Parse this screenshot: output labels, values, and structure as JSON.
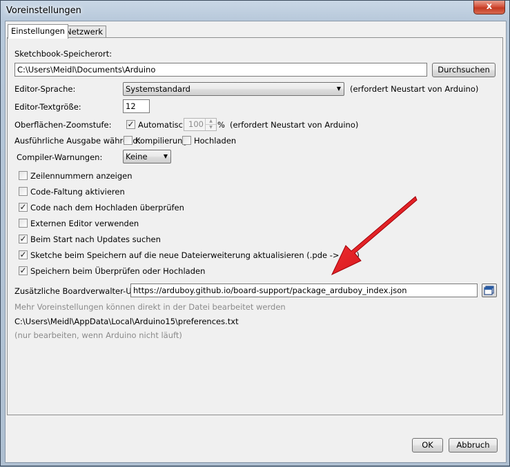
{
  "window": {
    "title": "Voreinstellungen",
    "close_glyph": "x"
  },
  "tabs": [
    {
      "label": "Einstellungen"
    },
    {
      "label": "Netzwerk"
    }
  ],
  "sketchbook": {
    "label": "Sketchbook-Speicherort:",
    "value": "C:\\Users\\Meidl\\Documents\\Arduino",
    "browse_label": "Durchsuchen"
  },
  "language": {
    "label": "Editor-Sprache:",
    "value": "Systemstandard",
    "note": "(erfordert Neustart von Arduino)"
  },
  "font_size": {
    "label": "Editor-Textgröße:",
    "value": "12"
  },
  "zoom": {
    "label": "Oberflächen-Zoomstufe:",
    "auto_label": "Automatisch",
    "auto_checked": true,
    "value": "100",
    "unit": "%",
    "note": "(erfordert Neustart von Arduino)"
  },
  "verbose": {
    "label": "Ausführliche Ausgabe während:",
    "compile_label": "Kompilierung",
    "compile_checked": false,
    "upload_label": "Hochladen",
    "upload_checked": false
  },
  "warnings": {
    "label": "Compiler-Warnungen:",
    "value": "Keine"
  },
  "options": [
    {
      "label": "Zeilennummern anzeigen",
      "checked": false
    },
    {
      "label": "Code-Faltung aktivieren",
      "checked": false
    },
    {
      "label": "Code nach dem Hochladen überprüfen",
      "checked": true
    },
    {
      "label": "Externen Editor verwenden",
      "checked": false
    },
    {
      "label": "Beim Start nach Updates suchen",
      "checked": true
    },
    {
      "label": "Sketche beim Speichern auf die neue Dateierweiterung aktualisieren (.pde -> .ino)",
      "checked": true
    },
    {
      "label": "Speichern beim Überprüfen oder Hochladen",
      "checked": true
    }
  ],
  "board_urls": {
    "label": "Zusätzliche Boardverwalter-URLs:",
    "value": "https://arduboy.github.io/board-support/package_arduboy_index.json"
  },
  "info": {
    "more_text": "Mehr Voreinstellungen können direkt in der Datei bearbeitet werden",
    "path": "C:\\Users\\Meidl\\AppData\\Local\\Arduino15\\preferences.txt",
    "hint": "(nur bearbeiten, wenn Arduino nicht läuft)"
  },
  "footer": {
    "ok_label": "OK",
    "cancel_label": "Abbruch"
  },
  "colors": {
    "arrow": "#e0141c"
  }
}
